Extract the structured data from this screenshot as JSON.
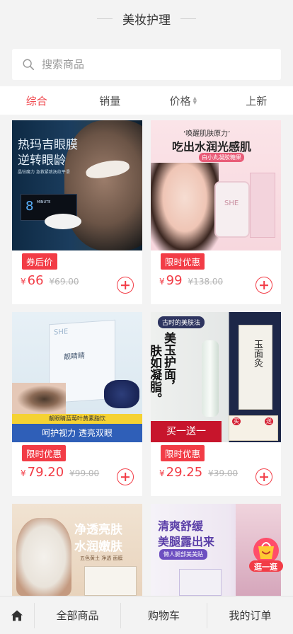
{
  "header": {
    "title": "美妆护理"
  },
  "search": {
    "placeholder": "搜索商品"
  },
  "sort_tabs": [
    {
      "label": "综合",
      "active": true
    },
    {
      "label": "销量",
      "active": false
    },
    {
      "label": "价格",
      "active": false
    },
    {
      "label": "上新",
      "active": false
    }
  ],
  "products": [
    {
      "tag": "券后价",
      "price": "66",
      "original_price": "¥69.00",
      "image_text": {
        "line1": "热玛吉眼膜",
        "line2": "逆转眼龄",
        "small": "晶钻魔力 急救紧致抚纹平滑",
        "brand": "8",
        "brand_sub": "MINUTE\nTIMELESS"
      }
    },
    {
      "tag": "限时优惠",
      "price": "99",
      "original_price": "¥138.00",
      "image_text": {
        "line1": "‘唤醒肌肤原力’",
        "line2": "吃出水润光感肌",
        "small": "白小丸凝胶糖果",
        "brand": "SHE"
      }
    },
    {
      "tag": "限时优惠",
      "price": "79.20",
      "original_price": "¥99.00",
      "image_text": {
        "line1": "靓眼睛蓝莓叶黄素脂饮",
        "line2": "呵护视力 透亮双眼",
        "brand": "SHE",
        "box": "靓睛睛"
      }
    },
    {
      "tag": "限时优惠",
      "price": "29.25",
      "original_price": "¥39.00",
      "image_text": {
        "line1": "古时的美肤法",
        "line2": "肤如凝脂。",
        "line3": "美玉护面，",
        "line4": "买一送一",
        "box": "玉面灸",
        "tag_buy": "买",
        "tag_gift": "送"
      }
    },
    {
      "tag": "",
      "price": "",
      "original_price": "",
      "image_text": {
        "line1": "净透亮肤",
        "line2": "水润嫩肤",
        "small": "五色黄土 净透 面膜"
      }
    },
    {
      "tag": "",
      "price": "",
      "original_price": "",
      "image_text": {
        "line1": "清爽舒缓",
        "line2": "美腿露出来",
        "small": "懒人腿部美美贴"
      }
    }
  ],
  "float_button": {
    "label": "逛一逛"
  },
  "bottom_nav": {
    "home_icon": "home-icon",
    "items": [
      "全部商品",
      "购物车",
      "我的订单"
    ]
  },
  "colors": {
    "accent": "#f23c46",
    "active_tab": "#f0484e"
  }
}
